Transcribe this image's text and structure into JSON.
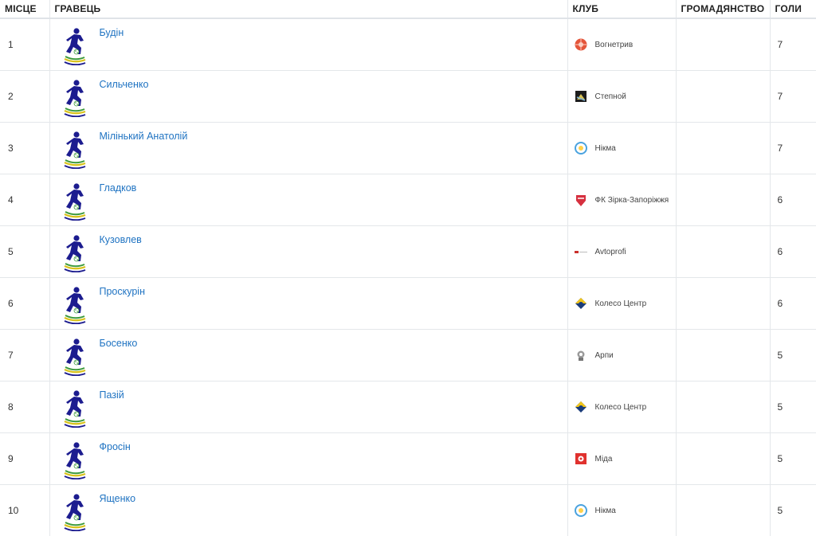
{
  "headers": {
    "place": "МІСЦЕ",
    "player": "ГРАВЕЦЬ",
    "club": "КЛУБ",
    "citizenship": "ГРОМАДЯНСТВО",
    "goals": "ГОЛИ"
  },
  "colors": {
    "link": "#1f73c2",
    "avatar_figure": "#1c1c8f",
    "avatar_stripe_green": "#3c9a3a",
    "avatar_stripe_yellow": "#d9c21a"
  },
  "rows": [
    {
      "place": "1",
      "player": "Будін",
      "club": "Вогнетрив",
      "club_icon": "vohnetryv-logo-icon",
      "citizenship": "",
      "goals": "7"
    },
    {
      "place": "2",
      "player": "Сильченко",
      "club": "Степной",
      "club_icon": "stepnoi-logo-icon",
      "citizenship": "",
      "goals": "7"
    },
    {
      "place": "3",
      "player": "Мілінький Анатолій",
      "club": "Нікма",
      "club_icon": "nikma-logo-icon",
      "citizenship": "",
      "goals": "7"
    },
    {
      "place": "4",
      "player": "Гладков",
      "club": "ФК Зірка-Запоріжжя",
      "club_icon": "zirka-logo-icon",
      "citizenship": "",
      "goals": "6"
    },
    {
      "place": "5",
      "player": "Кузовлев",
      "club": "Avtoprofi",
      "club_icon": "avtoprofi-logo-icon",
      "citizenship": "",
      "goals": "6"
    },
    {
      "place": "6",
      "player": "Проскурін",
      "club": "Колесо Центр",
      "club_icon": "koleso-logo-icon",
      "citizenship": "",
      "goals": "6"
    },
    {
      "place": "7",
      "player": "Босенко",
      "club": "Арпи",
      "club_icon": "arpy-logo-icon",
      "citizenship": "",
      "goals": "5"
    },
    {
      "place": "8",
      "player": "Пазій",
      "club": "Колесо Центр",
      "club_icon": "koleso-logo-icon",
      "citizenship": "",
      "goals": "5"
    },
    {
      "place": "9",
      "player": "Фросін",
      "club": "Міда",
      "club_icon": "mida-logo-icon",
      "citizenship": "",
      "goals": "5"
    },
    {
      "place": "10",
      "player": "Ященко",
      "club": "Нікма",
      "club_icon": "nikma-logo-icon",
      "citizenship": "",
      "goals": "5"
    }
  ]
}
